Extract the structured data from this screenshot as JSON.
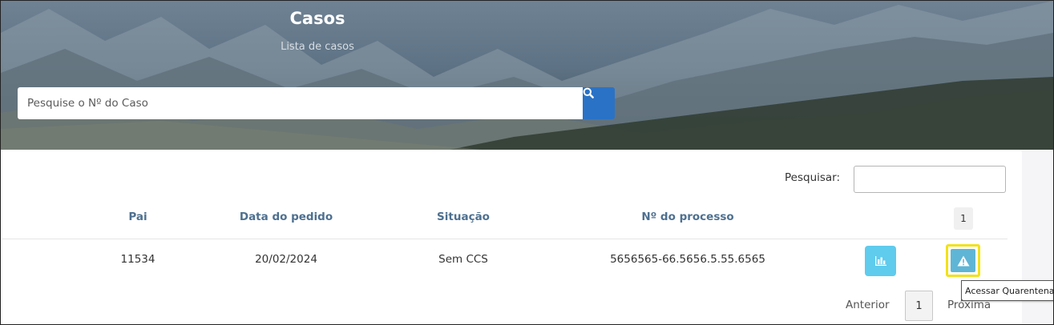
{
  "header": {
    "title": "Casos",
    "subtitle": "Lista de casos",
    "search_placeholder": "Pesquise o Nº do Caso",
    "search_icon": "search-icon"
  },
  "table_controls": {
    "filter_label": "Pesquisar:",
    "filter_value": ""
  },
  "table": {
    "columns": [
      "Pai",
      "Data do pedido",
      "Situação",
      "Nº do processo"
    ],
    "column_badge": "1",
    "rows": [
      {
        "pai": "11534",
        "data_pedido": "20/02/2024",
        "situacao": "Sem CCS",
        "processo": "5656565-66.5656.5.55.6565",
        "actions": [
          "bar-chart-icon",
          "warning-icon"
        ]
      }
    ]
  },
  "tooltip": {
    "text": "Acessar Quarentena"
  },
  "pagination": {
    "previous_label": "Anterior",
    "current_page": "1",
    "next_label": "Próxima"
  },
  "colors": {
    "primary_blue": "#2a72c6",
    "header_text": "#4d7090",
    "chart_button": "#5fcbed",
    "warning_button": "#5fb5d6",
    "highlight": "#f2e21a"
  }
}
